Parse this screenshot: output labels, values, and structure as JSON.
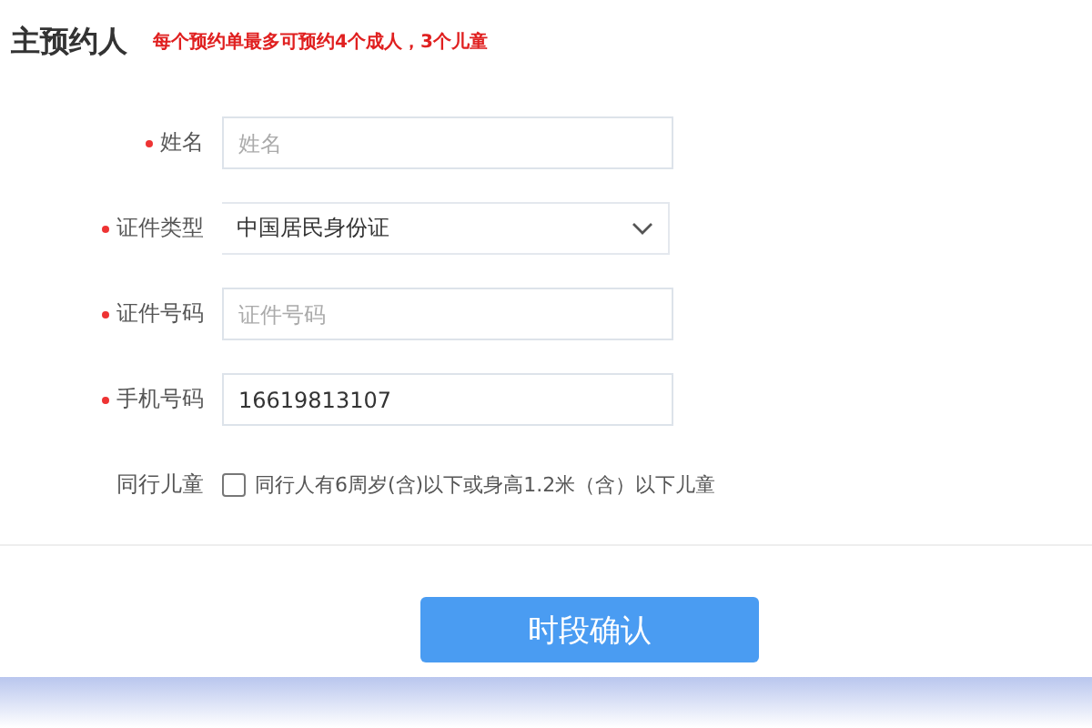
{
  "title": "主预约人",
  "note": "每个预约单最多可预约4个成人，3个儿童",
  "fields": [
    {
      "kind": "input",
      "label": "姓名",
      "required": true,
      "placeholder": "姓名"
    },
    {
      "kind": "select",
      "label": "证件类型",
      "required": true,
      "value": "中国居民身份证"
    },
    {
      "kind": "input",
      "label": "证件号码",
      "required": true,
      "placeholder": "证件号码"
    },
    {
      "kind": "input",
      "label": "手机号码",
      "required": true,
      "value": "16619813107"
    },
    {
      "kind": "checkbox",
      "label": "同行儿童",
      "required": false,
      "text": "同行人有6周岁(含)以下或身高1.2米（含）以下儿童",
      "checked": false
    }
  ],
  "submit": "时段确认"
}
